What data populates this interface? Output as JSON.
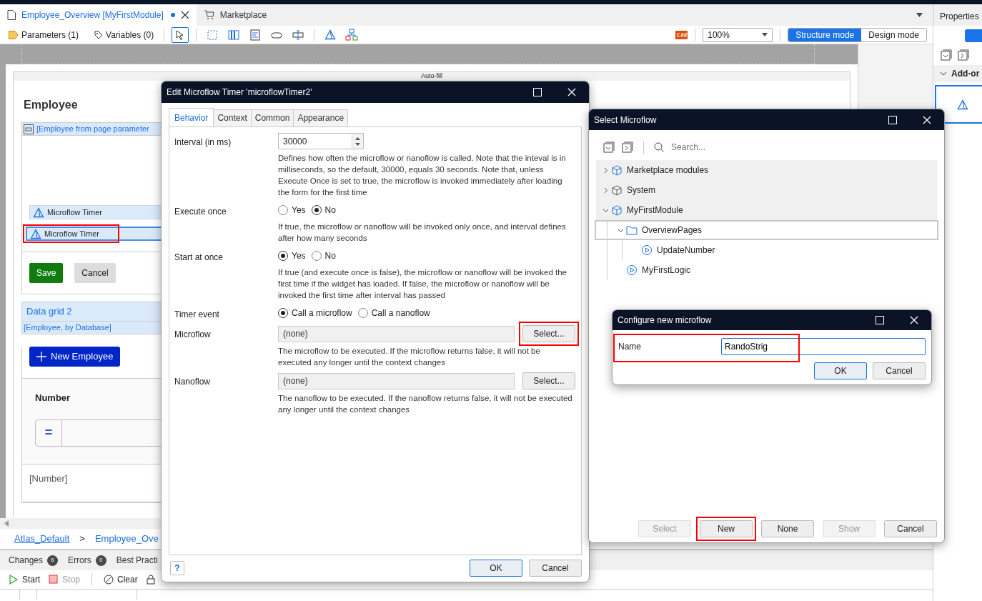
{
  "editor_tabs": [
    {
      "label": "Employee_Overview [MyFirstModule]",
      "selected": true,
      "unsaved": true
    },
    {
      "label": "Marketplace",
      "selected": false,
      "unsaved": false
    }
  ],
  "toolbar": {
    "parameters": "Parameters (1)",
    "variables": "Variables (0)",
    "zoom": "100%",
    "modes": [
      {
        "label": "Structure mode",
        "selected": true
      },
      {
        "label": "Design mode",
        "selected": false
      }
    ]
  },
  "canvas": {
    "autofill": "Auto-fill",
    "heading": "Employee",
    "dataview": "[Employee from page parameter",
    "timers": [
      {
        "label": "Microflow Timer",
        "selected": false,
        "highlighted": false
      },
      {
        "label": "Microflow Timer",
        "selected": true,
        "highlighted": true
      }
    ],
    "save": "Save",
    "cancel": "Cancel",
    "grid_title": "Data grid 2",
    "grid_source": "[Employee, by Database]",
    "new_button": "New Employee",
    "column": "Number",
    "filter_symbol": "=",
    "cell": "[Number]"
  },
  "breadcrumb": {
    "items": [
      "Atlas_Default",
      "Employee_Ove"
    ],
    "separator": ">"
  },
  "bottom_panel": {
    "tabs": [
      {
        "label": "Changes",
        "count": "6"
      },
      {
        "label": "Errors",
        "count": "0"
      },
      {
        "label": "Best Practi"
      }
    ],
    "actions": [
      {
        "label": "Start",
        "disabled": false
      },
      {
        "label": "Stop",
        "disabled": true
      },
      {
        "label": "Clear",
        "disabled": false
      }
    ]
  },
  "properties_panel": {
    "title": "Properties",
    "section": "Add-or"
  },
  "edit_dialog": {
    "title": "Edit Microflow Timer 'microflowTimer2'",
    "tabs": [
      {
        "label": "Behavior",
        "selected": true
      },
      {
        "label": "Context",
        "selected": false
      },
      {
        "label": "Common",
        "selected": false
      },
      {
        "label": "Appearance",
        "selected": false
      }
    ],
    "fields": [
      {
        "kind": "number",
        "label": "Interval (in ms)",
        "value": "30000",
        "help": "Defines how often the microflow or nanoflow is called. Note that the inteval is in milliseconds, so the default, 30000, equals 30 seconds. Note that, unless Execute Once is set to true, the microflow is invoked immediately after loading the form for the first time"
      },
      {
        "kind": "radio",
        "label": "Execute once",
        "options": [
          {
            "label": "Yes",
            "selected": false
          },
          {
            "label": "No",
            "selected": true
          }
        ],
        "help": "If true, the microflow or nanoflow will be invoked only once, and interval defines after how many seconds"
      },
      {
        "kind": "radio",
        "label": "Start at once",
        "options": [
          {
            "label": "Yes",
            "selected": true
          },
          {
            "label": "No",
            "selected": false
          }
        ],
        "help": "If true (and execute once is false), the microflow or nanoflow will be invoked the first time if the widget has loaded. If false, the microflow or nanoflow will be invoked the first time after interval has passed"
      },
      {
        "kind": "radio",
        "label": "Timer event",
        "options": [
          {
            "label": "Call a microflow",
            "selected": true
          },
          {
            "label": "Call a nanoflow",
            "selected": false
          }
        ]
      },
      {
        "kind": "select",
        "label": "Microflow",
        "value": "(none)",
        "button": "Select...",
        "highlighted": true,
        "help": "The microflow to be executed. If the microflow returns false, it will not be executed any longer until the context changes"
      },
      {
        "kind": "select",
        "label": "Nanoflow",
        "value": "(none)",
        "button": "Select...",
        "highlighted": false,
        "help": "The nanoflow to be executed. If the nanoflow returns false, it will not be executed any longer until the context changes"
      }
    ],
    "help_button": "?",
    "ok": "OK",
    "cancel": "Cancel"
  },
  "select_dialog": {
    "title": "Select Microflow",
    "search": {
      "placeholder": "Search..."
    },
    "tree": [
      {
        "label": "Marketplace modules",
        "kind": "module",
        "expanded": false,
        "selected": false
      },
      {
        "label": "System",
        "kind": "system",
        "expanded": false,
        "selected": false
      },
      {
        "label": "MyFirstModule",
        "kind": "module",
        "expanded": true,
        "selected": false,
        "children": [
          {
            "label": "OverviewPages",
            "kind": "folder",
            "expanded": true,
            "selected": true,
            "children": [
              {
                "label": "UpdateNumber",
                "kind": "microflow",
                "selected": false
              }
            ]
          },
          {
            "label": "MyFirstLogic",
            "kind": "microflow",
            "selected": false
          }
        ]
      }
    ],
    "buttons": [
      {
        "label": "Select",
        "disabled": true,
        "highlighted": false
      },
      {
        "label": "New",
        "disabled": false,
        "highlighted": true
      },
      {
        "label": "None",
        "disabled": false,
        "highlighted": false
      },
      {
        "label": "Show",
        "disabled": true,
        "highlighted": false
      },
      {
        "label": "Cancel",
        "disabled": false,
        "highlighted": false
      }
    ]
  },
  "configure_dialog": {
    "title": "Configure new microflow",
    "label": "Name",
    "value": "RandoStrig",
    "highlighted": true,
    "ok": "OK",
    "cancel": "Cancel"
  }
}
